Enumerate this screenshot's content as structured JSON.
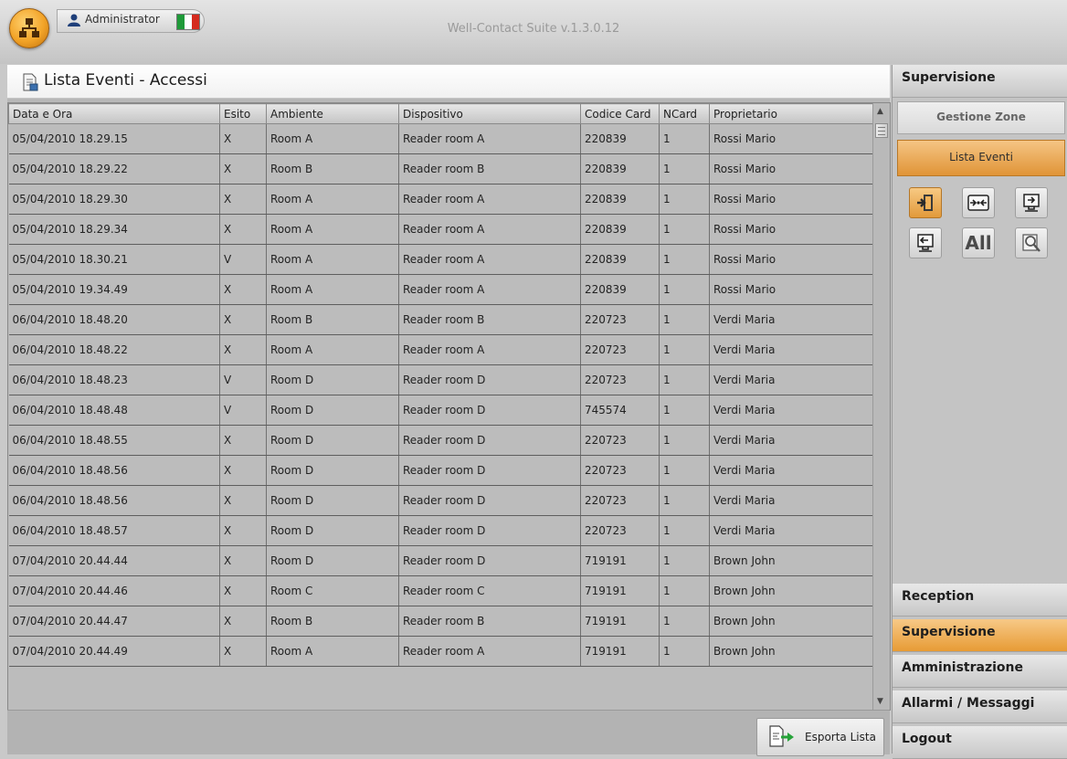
{
  "titlebar": {
    "user": "Administrator",
    "flag_colors": [
      "#1f9a39",
      "#ffffff",
      "#d52b1e"
    ],
    "app_title": "Well-Contact Suite v.1.3.0.12"
  },
  "list": {
    "title": "Lista Eventi - Accessi",
    "columns": [
      "Data e Ora",
      "Esito",
      "Ambiente",
      "Dispositivo",
      "Codice Card",
      "NCard",
      "Proprietario"
    ],
    "rows": [
      [
        "05/04/2010 18.29.15",
        "X",
        "Room A",
        "Reader room A",
        "220839",
        "1",
        "Rossi Mario"
      ],
      [
        "05/04/2010 18.29.22",
        "X",
        "Room B",
        "Reader room B",
        "220839",
        "1",
        "Rossi Mario"
      ],
      [
        "05/04/2010 18.29.30",
        "X",
        "Room A",
        "Reader room A",
        "220839",
        "1",
        "Rossi Mario"
      ],
      [
        "05/04/2010 18.29.34",
        "X",
        "Room A",
        "Reader room A",
        "220839",
        "1",
        "Rossi Mario"
      ],
      [
        "05/04/2010 18.30.21",
        "V",
        "Room A",
        "Reader room A",
        "220839",
        "1",
        "Rossi Mario"
      ],
      [
        "05/04/2010 19.34.49",
        "X",
        "Room A",
        "Reader room A",
        "220839",
        "1",
        "Rossi Mario"
      ],
      [
        "06/04/2010 18.48.20",
        "X",
        "Room B",
        "Reader room B",
        "220723",
        "1",
        "Verdi Maria"
      ],
      [
        "06/04/2010 18.48.22",
        "X",
        "Room A",
        "Reader room A",
        "220723",
        "1",
        "Verdi Maria"
      ],
      [
        "06/04/2010 18.48.23",
        "V",
        "Room D",
        "Reader room D",
        "220723",
        "1",
        "Verdi Maria"
      ],
      [
        "06/04/2010 18.48.48",
        "V",
        "Room D",
        "Reader room D",
        "745574",
        "1",
        "Verdi Maria"
      ],
      [
        "06/04/2010 18.48.55",
        "X",
        "Room D",
        "Reader room D",
        "220723",
        "1",
        "Verdi Maria"
      ],
      [
        "06/04/2010 18.48.56",
        "X",
        "Room D",
        "Reader room D",
        "220723",
        "1",
        "Verdi Maria"
      ],
      [
        "06/04/2010 18.48.56",
        "X",
        "Room D",
        "Reader room D",
        "220723",
        "1",
        "Verdi Maria"
      ],
      [
        "06/04/2010 18.48.57",
        "X",
        "Room D",
        "Reader room D",
        "220723",
        "1",
        "Verdi Maria"
      ],
      [
        "07/04/2010 20.44.44",
        "X",
        "Room D",
        "Reader room D",
        "719191",
        "1",
        "Brown John"
      ],
      [
        "07/04/2010 20.44.46",
        "X",
        "Room C",
        "Reader room C",
        "719191",
        "1",
        "Brown John"
      ],
      [
        "07/04/2010 20.44.47",
        "X",
        "Room B",
        "Reader room B",
        "719191",
        "1",
        "Brown John"
      ],
      [
        "07/04/2010 20.44.49",
        "X",
        "Room A",
        "Reader room A",
        "719191",
        "1",
        "Brown John"
      ]
    ],
    "export_label": "Esporta Lista"
  },
  "sidebar": {
    "top_header": "Supervisione",
    "sub_items": [
      "Gestione Zone",
      "Lista Eventi"
    ],
    "filter_icons": [
      "access-events-icon",
      "transit-events-icon",
      "device-in-icon",
      "device-out-icon",
      "all-events-icon",
      "search-events-icon"
    ],
    "all_label": "All",
    "sections": [
      "Reception",
      "Supervisione",
      "Amministrazione",
      "Allarmi / Messaggi",
      "Logout"
    ],
    "active_section": "Supervisione",
    "accent_color": "#e89a35"
  }
}
